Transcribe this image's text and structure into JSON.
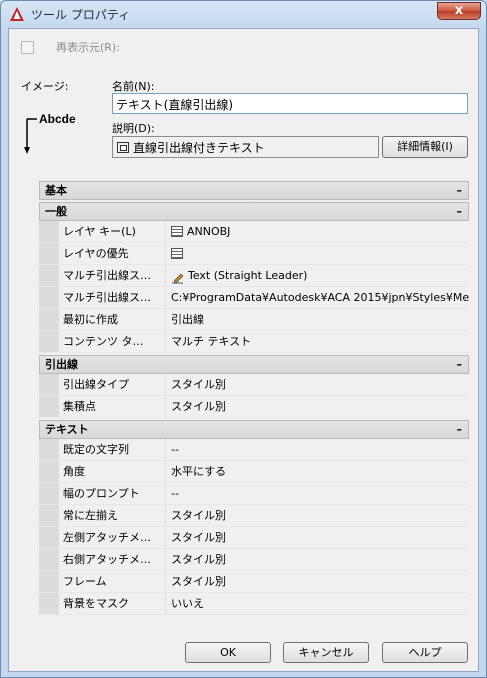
{
  "window": {
    "title": "ツール プロパティ",
    "close_label": "x"
  },
  "redisplay": {
    "label": "再表示元(R):"
  },
  "image_label": "イメージ:",
  "preview_text": "Abcde",
  "name": {
    "label": "名前(N):",
    "value": "テキスト(直線引出線)"
  },
  "description": {
    "label": "説明(D):",
    "value": "直線引出線付きテキスト"
  },
  "details_button": "詳細情報(I)",
  "sections": [
    {
      "title": "基本",
      "toggle": "–",
      "rows": []
    },
    {
      "title": "一般",
      "toggle": "–",
      "rows": [
        {
          "key": "レイヤ キー(L)",
          "value": "ANNOBJ",
          "icon": "layer-icon"
        },
        {
          "key": "レイヤの優先",
          "value": "",
          "icon": "layer-icon"
        },
        {
          "key": "マルチ引出線ス…",
          "value": "Text (Straight Leader)",
          "icon": "pen-icon"
        },
        {
          "key": "マルチ引出線ス…",
          "value": "C:¥ProgramData¥Autodesk¥ACA  2015¥jpn¥Styles¥Met…"
        },
        {
          "key": "最初に作成",
          "value": "引出線"
        },
        {
          "key": "コンテンツ タ…",
          "value": "マルチ テキスト"
        }
      ]
    },
    {
      "title": "引出線",
      "toggle": "–",
      "rows": [
        {
          "key": "引出線タイプ",
          "value": "スタイル別"
        },
        {
          "key": "集積点",
          "value": "スタイル別"
        }
      ]
    },
    {
      "title": "テキスト",
      "toggle": "–",
      "rows": [
        {
          "key": "既定の文字列",
          "value": "--"
        },
        {
          "key": "角度",
          "value": "水平にする"
        },
        {
          "key": "幅のプロンプト",
          "value": "--"
        },
        {
          "key": "常に左揃え",
          "value": "スタイル別"
        },
        {
          "key": "左側アタッチメ…",
          "value": "スタイル別"
        },
        {
          "key": "右側アタッチメ…",
          "value": "スタイル別"
        },
        {
          "key": "フレーム",
          "value": "スタイル別"
        },
        {
          "key": "背景をマスク",
          "value": "いいえ"
        }
      ]
    }
  ],
  "buttons": {
    "ok": "OK",
    "cancel": "キャンセル",
    "help": "ヘルプ"
  },
  "colors": {
    "accent": "#c9563d",
    "section_bg": "#dcdcdc"
  }
}
